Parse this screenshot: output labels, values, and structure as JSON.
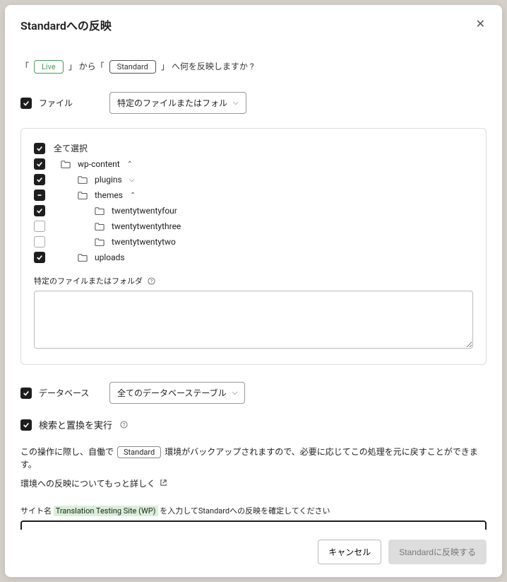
{
  "modal": {
    "title": "Standardへの反映",
    "source_prefix": "「",
    "source_live": "Live",
    "source_mid": "」 から「",
    "source_std": "Standard",
    "source_suffix": "」 へ何を反映しますか ?"
  },
  "files": {
    "label": "ファイル",
    "dropdown": "特定のファイルまたはフォル"
  },
  "tree": {
    "select_all": "全て選択",
    "items": [
      {
        "name": "wp-content",
        "checked": true,
        "expanded": true,
        "indent": 1,
        "folder": true,
        "hasChevron": true
      },
      {
        "name": "plugins",
        "checked": true,
        "expanded": false,
        "indent": 2,
        "folder": true,
        "hasChevron": true
      },
      {
        "name": "themes",
        "checked": "partial",
        "expanded": true,
        "indent": 2,
        "folder": true,
        "hasChevron": true
      },
      {
        "name": "twentytwentyfour",
        "checked": true,
        "indent": 3,
        "folder": true,
        "hasChevron": false
      },
      {
        "name": "twentytwentythree",
        "checked": false,
        "indent": 3,
        "folder": true,
        "hasChevron": false
      },
      {
        "name": "twentytwentytwo",
        "checked": false,
        "indent": 3,
        "folder": true,
        "hasChevron": false
      },
      {
        "name": "uploads",
        "checked": true,
        "indent": 2,
        "folder": true,
        "hasChevron": false
      }
    ],
    "specific_label": "特定のファイルまたはフォルダ"
  },
  "database": {
    "label": "データベース",
    "dropdown": "全てのデータベーステーブル"
  },
  "search": {
    "label": "検索と置換を実行"
  },
  "notes": {
    "backup_prefix": "この操作に際し、自働で",
    "backup_pill": "Standard",
    "backup_suffix": "環境がバックアップされますので、必要に応じてこの処理を元に戻すことができます。",
    "learn_more": "環境への反映についてもっと詳しく"
  },
  "confirm": {
    "prefix": "サイト名",
    "site_name": "Translation Testing Site (WP)",
    "suffix": "を入力してStandardへの反映を確定してください"
  },
  "footer": {
    "cancel": "キャンセル",
    "submit": "Standardに反映する"
  }
}
